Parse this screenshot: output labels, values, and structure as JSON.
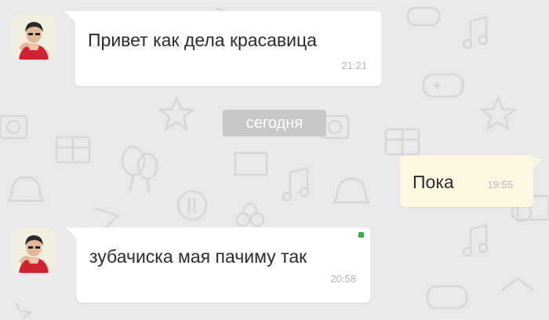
{
  "date_separator": "сегодня",
  "messages": [
    {
      "direction": "incoming",
      "text": "Привет как дела красавица",
      "time": "21:21"
    },
    {
      "direction": "outgoing",
      "text": "Пока",
      "time": "19:55"
    },
    {
      "direction": "incoming",
      "text": "зубачиска мая  пачиму так",
      "time": "20:58"
    }
  ],
  "colors": {
    "background": "#e9e9e9",
    "incoming_bubble": "#ffffff",
    "outgoing_bubble": "#fdf7e1",
    "date_separator_bg": "#c7c7c7",
    "online_indicator": "#33b53a"
  }
}
